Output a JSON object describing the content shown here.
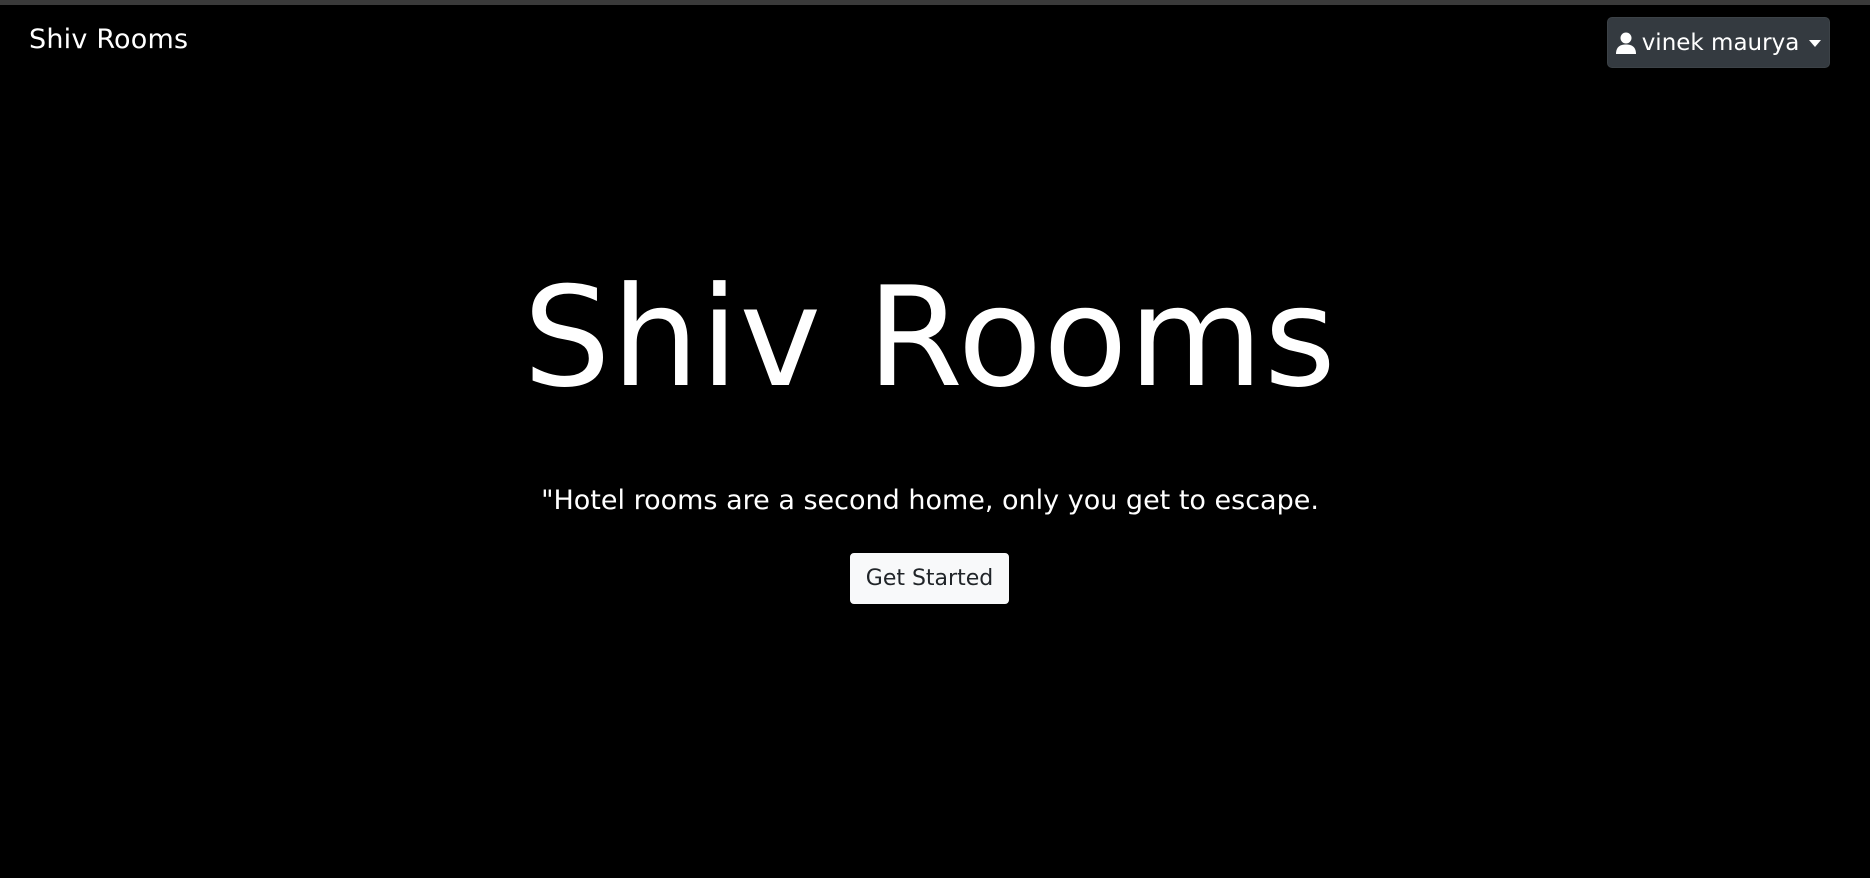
{
  "navbar": {
    "brand": "Shiv Rooms",
    "user_menu": {
      "label": "vinek maurya",
      "icon": "user-icon"
    }
  },
  "hero": {
    "title": "Shiv Rooms",
    "quote": "\"Hotel rooms are a second home, only you get to escape.",
    "cta_label": "Get Started"
  },
  "colors": {
    "background": "#000000",
    "text": "#ffffff",
    "user_button_bg": "#343a40",
    "cta_bg": "#f8f9fa",
    "cta_text": "#212529"
  }
}
